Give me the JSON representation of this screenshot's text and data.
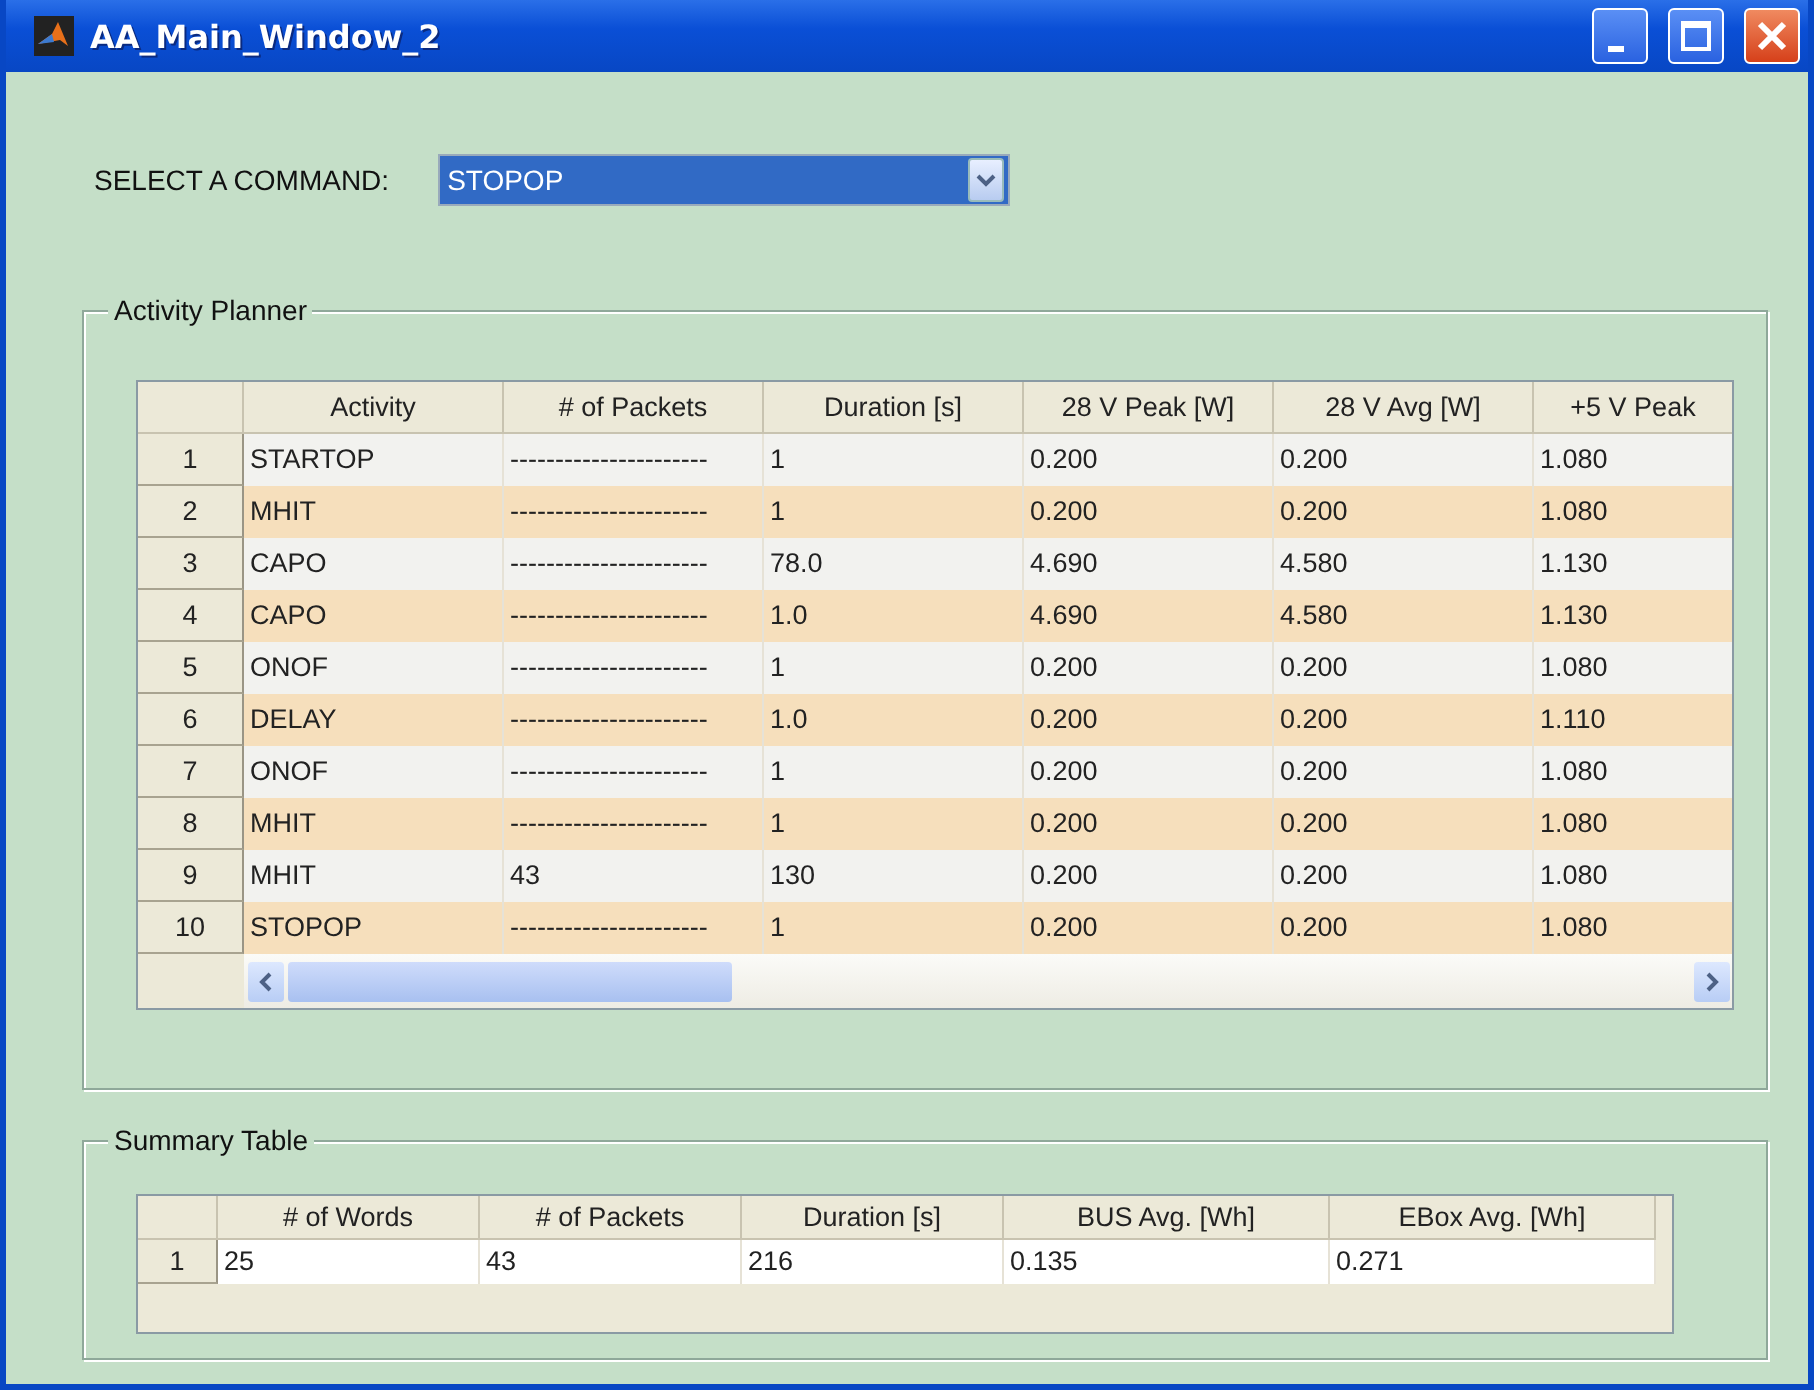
{
  "window": {
    "title": "AA_Main_Window_2"
  },
  "command": {
    "label": "SELECT A COMMAND:",
    "value": "STOPOP"
  },
  "activity_planner": {
    "title": "Activity Planner",
    "columns": [
      "Activity",
      "# of Packets",
      "Duration [s]",
      "28 V Peak [W]",
      "28 V Avg [W]",
      "+5 V Peak"
    ],
    "rows": [
      {
        "number": "1",
        "cells": [
          "STARTOP",
          "----------------------",
          "1",
          "0.200",
          "0.200",
          "1.080"
        ]
      },
      {
        "number": "2",
        "cells": [
          "MHIT",
          "----------------------",
          "1",
          "0.200",
          "0.200",
          "1.080"
        ]
      },
      {
        "number": "3",
        "cells": [
          "CAPO",
          "----------------------",
          "78.0",
          "4.690",
          "4.580",
          "1.130"
        ]
      },
      {
        "number": "4",
        "cells": [
          "CAPO",
          "----------------------",
          "1.0",
          "4.690",
          "4.580",
          "1.130"
        ]
      },
      {
        "number": "5",
        "cells": [
          "ONOF",
          "----------------------",
          "1",
          "0.200",
          "0.200",
          "1.080"
        ]
      },
      {
        "number": "6",
        "cells": [
          "DELAY",
          "----------------------",
          "1.0",
          "0.200",
          "0.200",
          "1.110"
        ]
      },
      {
        "number": "7",
        "cells": [
          "ONOF",
          "----------------------",
          "1",
          "0.200",
          "0.200",
          "1.080"
        ]
      },
      {
        "number": "8",
        "cells": [
          "MHIT",
          "----------------------",
          "1",
          "0.200",
          "0.200",
          "1.080"
        ]
      },
      {
        "number": "9",
        "cells": [
          "MHIT",
          "43",
          "130",
          "0.200",
          "0.200",
          "1.080"
        ]
      },
      {
        "number": "10",
        "cells": [
          "STOPOP",
          "----------------------",
          "1",
          "0.200",
          "0.200",
          "1.080"
        ]
      }
    ]
  },
  "summary_table": {
    "title": "Summary Table",
    "columns": [
      "# of Words",
      "# of Packets",
      "Duration [s]",
      "BUS Avg. [Wh]",
      "EBox Avg. [Wh]"
    ],
    "rows": [
      {
        "number": "1",
        "cells": [
          "25",
          "43",
          "216",
          "0.135",
          "0.271"
        ]
      }
    ]
  }
}
